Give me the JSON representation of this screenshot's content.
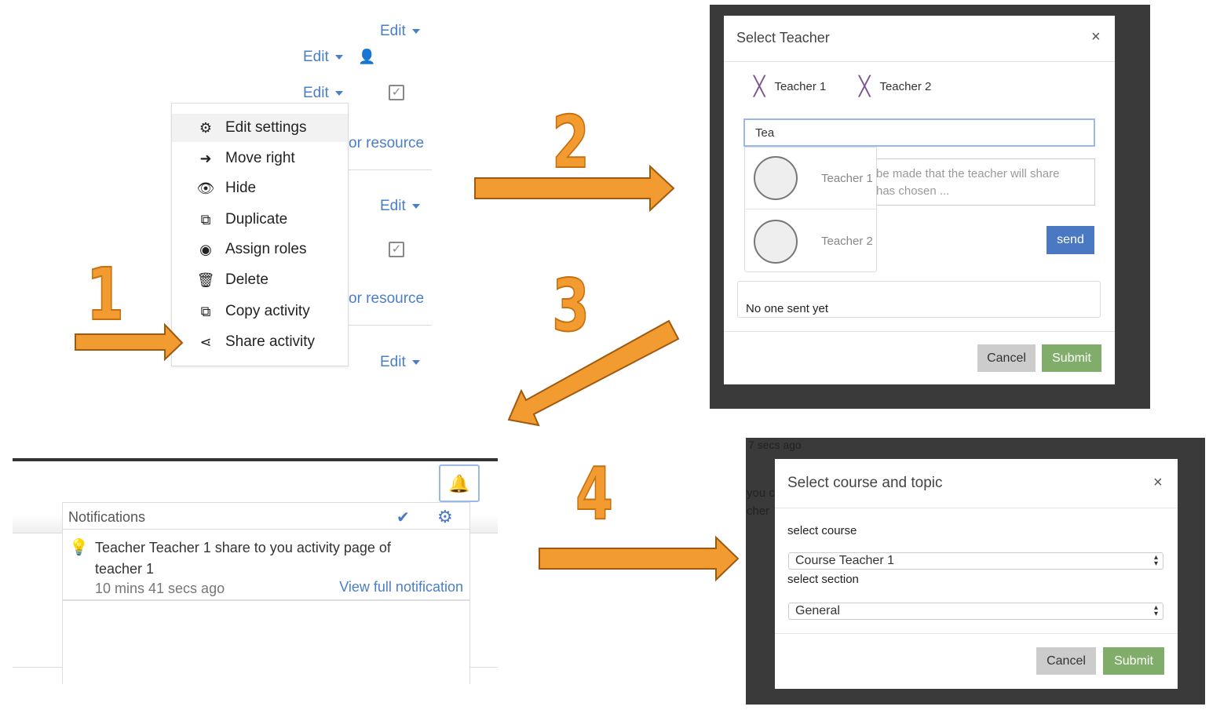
{
  "step_numbers": [
    "1",
    "2",
    "3",
    "4"
  ],
  "colors": {
    "arrow": "#f29b30",
    "link": "#4a7fc8",
    "send": "#4a78c2",
    "submit": "#80ad6a",
    "cancel": "#cccccc"
  },
  "course_page": {
    "edit_label": "Edit",
    "resource_text": "or resource",
    "menu": [
      {
        "icon": "gear-icon",
        "label": "Edit settings"
      },
      {
        "icon": "arrow-right-icon",
        "label": "Move right"
      },
      {
        "icon": "eye-icon",
        "label": "Hide"
      },
      {
        "icon": "duplicate-icon",
        "label": "Duplicate"
      },
      {
        "icon": "user-circle-icon",
        "label": "Assign roles"
      },
      {
        "icon": "trash-icon",
        "label": "Delete"
      },
      {
        "icon": "copy-icon",
        "label": "Copy activity"
      },
      {
        "icon": "share-icon",
        "label": "Share activity"
      }
    ]
  },
  "select_teacher": {
    "title": "Select Teacher",
    "close": "×",
    "selected": [
      "Teacher 1",
      "Teacher 2"
    ],
    "search_value": "Tea",
    "suggestions": [
      "Teacher 1",
      "Teacher 2"
    ],
    "message_line1": "be made that the teacher will share",
    "message_line2": "has chosen ...",
    "send_label": "send",
    "sent_status": "No one sent yet",
    "cancel_label": "Cancel",
    "submit_label": "Submit"
  },
  "notifications": {
    "title": "Notifications",
    "message_line1": "Teacher Teacher 1 share to you activity page of",
    "message_line2": "teacher 1",
    "time": "10 mins 41 secs ago",
    "view_link": "View full notification"
  },
  "select_course": {
    "bg_time": "7 secs ago",
    "bg_text1": "you c",
    "bg_text2": "cher",
    "title": "Select course and topic",
    "close": "×",
    "course_label": "select course",
    "course_value": "Course Teacher 1",
    "section_label": "select section",
    "section_value": "General",
    "cancel_label": "Cancel",
    "submit_label": "Submit"
  }
}
